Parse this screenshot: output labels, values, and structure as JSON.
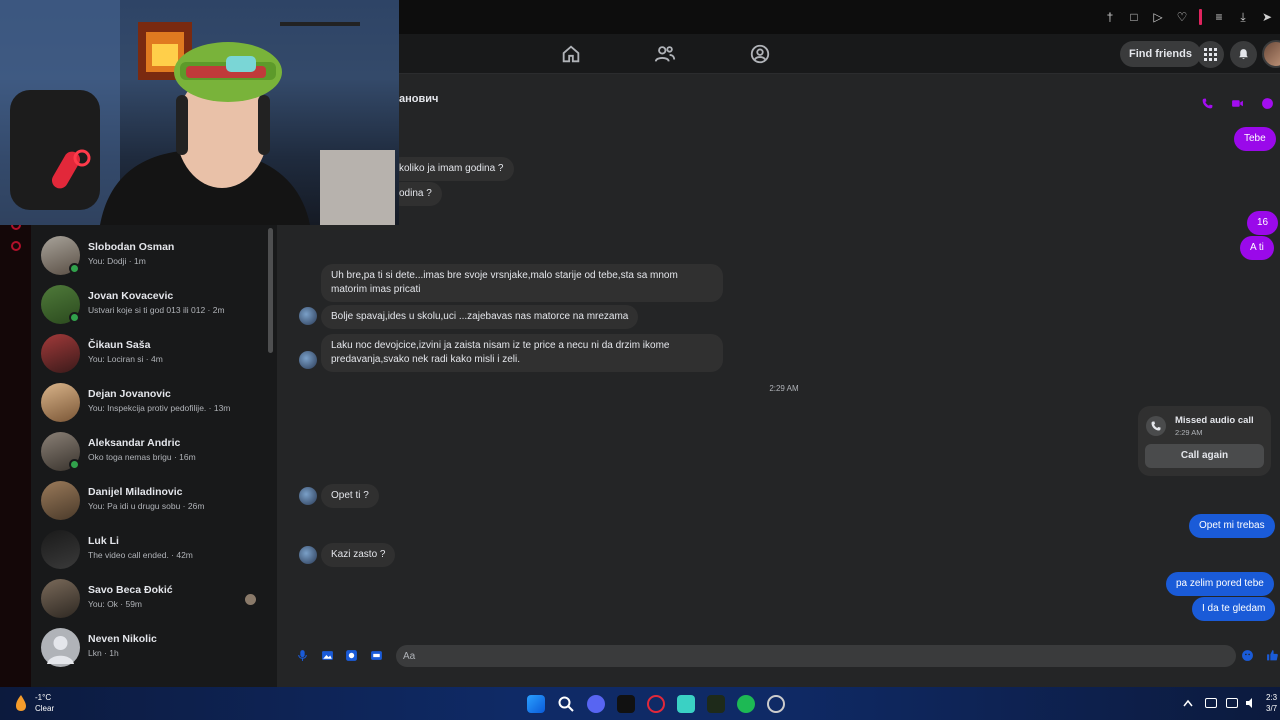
{
  "header": {
    "find_friends": "Find friends"
  },
  "chat": {
    "partner_name_visible": "анович",
    "messages": [
      {
        "text": "Tebe",
        "dir": "out"
      },
      {
        "text": "koliko ja imam godina ?",
        "dir": "in"
      },
      {
        "text": "odina ?",
        "dir": "in"
      },
      {
        "text": "16",
        "dir": "out"
      },
      {
        "text": "A ti",
        "dir": "out"
      },
      {
        "text": "Uh bre,pa ti si dete...imas bre svoje vrsnjake,malo starije od tebe,sta sa mnom matorim imas pricati",
        "dir": "in"
      },
      {
        "text": "Bolje spavaj,ides u skolu,uci ...zajebavas nas matorce na mrezama",
        "dir": "in"
      },
      {
        "text": "Laku noc devojcice,izvini ja zaista nisam iz te price a necu ni da drzim ikome predavanja,svako nek radi kako misli i zeli.",
        "dir": "in"
      },
      {
        "text": "Opet ti ?",
        "dir": "in"
      },
      {
        "text": "Opet mi trebas",
        "dir": "out"
      },
      {
        "text": "Kazi zasto ?",
        "dir": "in"
      },
      {
        "text": "pa zelim pored tebe",
        "dir": "out"
      },
      {
        "text": "I da te gledam",
        "dir": "out"
      }
    ],
    "timestamp": "2:29 AM",
    "missed_call": {
      "title": "Missed audio call",
      "time": "2:29 AM",
      "button": "Call again"
    },
    "composer_placeholder": "Aa"
  },
  "sidebar": {
    "conversations": [
      {
        "name": "Slobodan Osman",
        "preview": "You: Dodji · 1m",
        "online": true
      },
      {
        "name": "Jovan Kovacevic",
        "preview": "Ustvari koje si ti god 013 ili 012 · 2m",
        "online": true
      },
      {
        "name": "Čikaun Saša",
        "preview": "You: Lociran si · 4m",
        "online": false
      },
      {
        "name": "Dejan Jovanovic",
        "preview": "You: Inspekcija protiv pedofilije. · 13m",
        "online": false
      },
      {
        "name": "Aleksandar Andric",
        "preview": "Oko toga nemas brigu · 16m",
        "online": true
      },
      {
        "name": "Danijel Miladinovic",
        "preview": "You: Pa idi u drugu sobu · 26m",
        "online": false
      },
      {
        "name": "Luk Li",
        "preview": "The video call ended. · 42m",
        "online": false
      },
      {
        "name": "Savo Beca Đokić",
        "preview": "You: Ok · 59m",
        "online": false
      },
      {
        "name": "Neven Nikolic",
        "preview": "Lkn · 1h",
        "online": false
      }
    ]
  },
  "taskbar": {
    "weather_temp": "-1°C",
    "weather_cond": "Clear",
    "clock_time": "2:3",
    "clock_date": "3/7"
  },
  "colors": {
    "outgoing_purple": "#9a09ea",
    "outgoing_blue": "#1a5bd8",
    "incoming": "#303030",
    "online": "#31a24c"
  }
}
